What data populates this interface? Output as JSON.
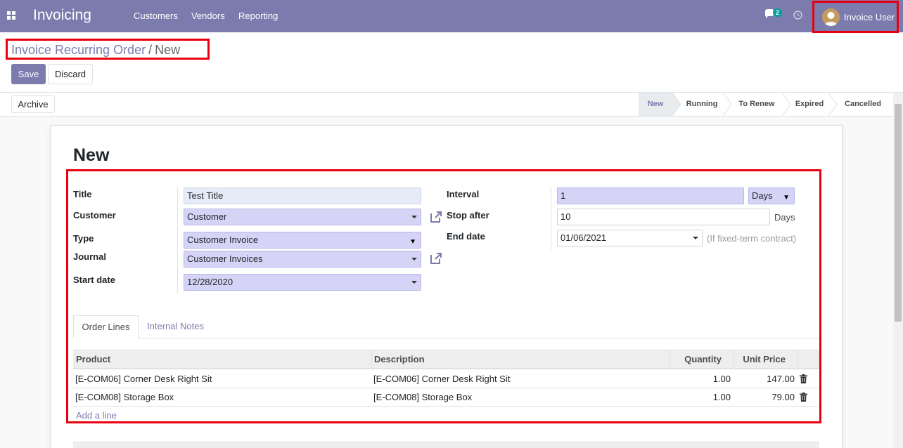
{
  "navbar": {
    "brand": "Invoicing",
    "menu": [
      "Customers",
      "Vendors",
      "Reporting"
    ],
    "chat_count": "2",
    "user_name": "Invoice User",
    "icons": {
      "apps": "apps-grid-icon",
      "chat": "chat-icon",
      "activity": "clock-icon"
    }
  },
  "control_panel": {
    "breadcrumb_parent": "Invoice Recurring Order",
    "breadcrumb_sep": "/",
    "breadcrumb_current": "New",
    "save_label": "Save",
    "discard_label": "Discard"
  },
  "statusbar": {
    "archive_label": "Archive",
    "stages": [
      "New",
      "Running",
      "To Renew",
      "Expired",
      "Cancelled"
    ],
    "active_stage": "New"
  },
  "form": {
    "title": "New",
    "left": {
      "title_label": "Title",
      "title_value": "Test Title",
      "customer_label": "Customer",
      "customer_value": "Customer",
      "type_label": "Type",
      "type_value": "Customer Invoice",
      "journal_label": "Journal",
      "journal_value": "Customer Invoices",
      "start_date_label": "Start date",
      "start_date_value": "12/28/2020"
    },
    "right": {
      "interval_label": "Interval",
      "interval_value": "1",
      "interval_unit": "Days",
      "stop_after_label": "Stop after",
      "stop_after_value": "10",
      "stop_after_unit": "Days",
      "end_date_label": "End date",
      "end_date_value": "01/06/2021",
      "end_date_hint": "(If fixed-term contract)"
    }
  },
  "tabs": {
    "order_lines": "Order Lines",
    "internal_notes": "Internal Notes"
  },
  "order_lines": {
    "columns": [
      "Product",
      "Description",
      "Quantity",
      "Unit Price"
    ],
    "rows": [
      {
        "product": "[E-COM06] Corner Desk Right Sit",
        "description": "[E-COM06] Corner Desk Right Sit",
        "quantity": "1.00",
        "unit_price": "147.00"
      },
      {
        "product": "[E-COM08] Storage Box",
        "description": "[E-COM08] Storage Box",
        "quantity": "1.00",
        "unit_price": "79.00"
      }
    ],
    "add_line": "Add a line"
  },
  "colors": {
    "brand": "#7c7bad",
    "highlight_border": "#e8000f",
    "required_field": "#d5d4f7"
  }
}
